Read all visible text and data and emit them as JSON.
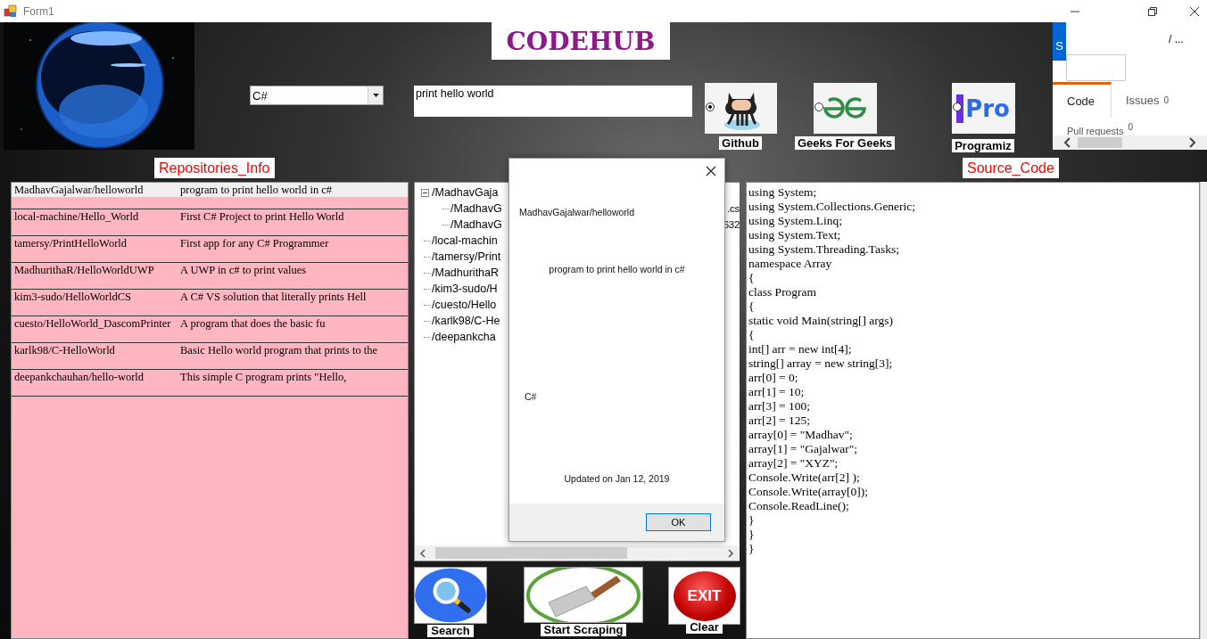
{
  "window": {
    "title": "Form1"
  },
  "header": {
    "title": "CODEHUB"
  },
  "language": {
    "value": "C#"
  },
  "query": {
    "value": "print hello world"
  },
  "sources": [
    {
      "label": "Github",
      "kind": "github",
      "selected": true
    },
    {
      "label": "Geeks For Geeks",
      "kind": "gfg",
      "selected": false
    },
    {
      "label": "Programiz",
      "kind": "programiz",
      "selected": false,
      "logo_text": "Pro"
    }
  ],
  "browser": {
    "badge": "S",
    "path": "/ ...",
    "tabs": [
      {
        "label": "Code",
        "selected": true
      },
      {
        "label": "Issues",
        "count": "0",
        "selected": false
      }
    ],
    "pull_requests": {
      "label": "Pull requests",
      "count": "0"
    }
  },
  "repositories": {
    "label": "Repositories_Info",
    "rows": [
      {
        "name": "MadhavGajalwar/helloworld",
        "description": "program to print hello world in c#",
        "selected": true
      },
      {
        "name": "local-machine/Hello_World",
        "description": "First C# Project to print Hello World",
        "selected": false
      },
      {
        "name": "tamersy/PrintHelloWorld",
        "description": "First app for any C# Programmer",
        "selected": false
      },
      {
        "name": "MadhurithaR/HelloWorldUWP",
        "description": "A UWP in c# to print values",
        "selected": false
      },
      {
        "name": "kim3-sudo/HelloWorldCS",
        "description": "A C# VS solution that literally prints Hell",
        "selected": false
      },
      {
        "name": "cuesto/HelloWorld_DascomPrinter",
        "description": "A program that does the basic fu",
        "selected": false
      },
      {
        "name": "karlk98/C-HelloWorld",
        "description": "Basic Hello world program that prints to the",
        "selected": false
      },
      {
        "name": "deepankchauhan/hello-world",
        "description": "This simple C program prints \"Hello,",
        "selected": false
      }
    ]
  },
  "tree": {
    "nodes": [
      {
        "text": "/MadhavGaja",
        "expanded": true,
        "children": [
          {
            "text": "/MadhavG",
            "tail": ".cs"
          },
          {
            "text": "/MadhavG",
            "tail": "632"
          }
        ]
      },
      {
        "text": "/local-machin"
      },
      {
        "text": "/tamersy/Print"
      },
      {
        "text": "/MadhurithaR"
      },
      {
        "text": "/kim3-sudo/H"
      },
      {
        "text": "/cuesto/Hello"
      },
      {
        "text": "/karlk98/C-He"
      },
      {
        "text": "/deepankcha"
      }
    ]
  },
  "dialog": {
    "name": "MadhavGajalwar/helloworld",
    "description": "program to print hello world in c#",
    "language": "C#",
    "updated": "Updated on Jan 12, 2019",
    "ok": "OK"
  },
  "source": {
    "label": "Source_Code",
    "lines": [
      "using System;",
      "using System.Collections.Generic;",
      "using System.Linq;",
      "using System.Text;",
      "using System.Threading.Tasks;",
      "namespace Array",
      "{",
      "class Program",
      "{",
      "static void Main(string[] args)",
      "{",
      "int[] arr = new int[4];",
      "string[] array = new string[3];",
      "arr[0] = 0;",
      "arr[1] = 10;",
      "arr[3] = 100;",
      "arr[2] = 125;",
      "array[0] = \"Madhav\";",
      "array[1] = \"Gajalwar\";",
      "array[2] = \"XYZ\";",
      "Console.Write(arr[2] );",
      "Console.Write(array[0]);",
      "Console.ReadLine();",
      "}",
      "}",
      "}"
    ]
  },
  "actions": [
    {
      "kind": "search",
      "label": "Search"
    },
    {
      "kind": "scrape",
      "label": "Start Scraping"
    },
    {
      "kind": "exit",
      "label": "Clear",
      "icon_text": "EXIT"
    }
  ]
}
